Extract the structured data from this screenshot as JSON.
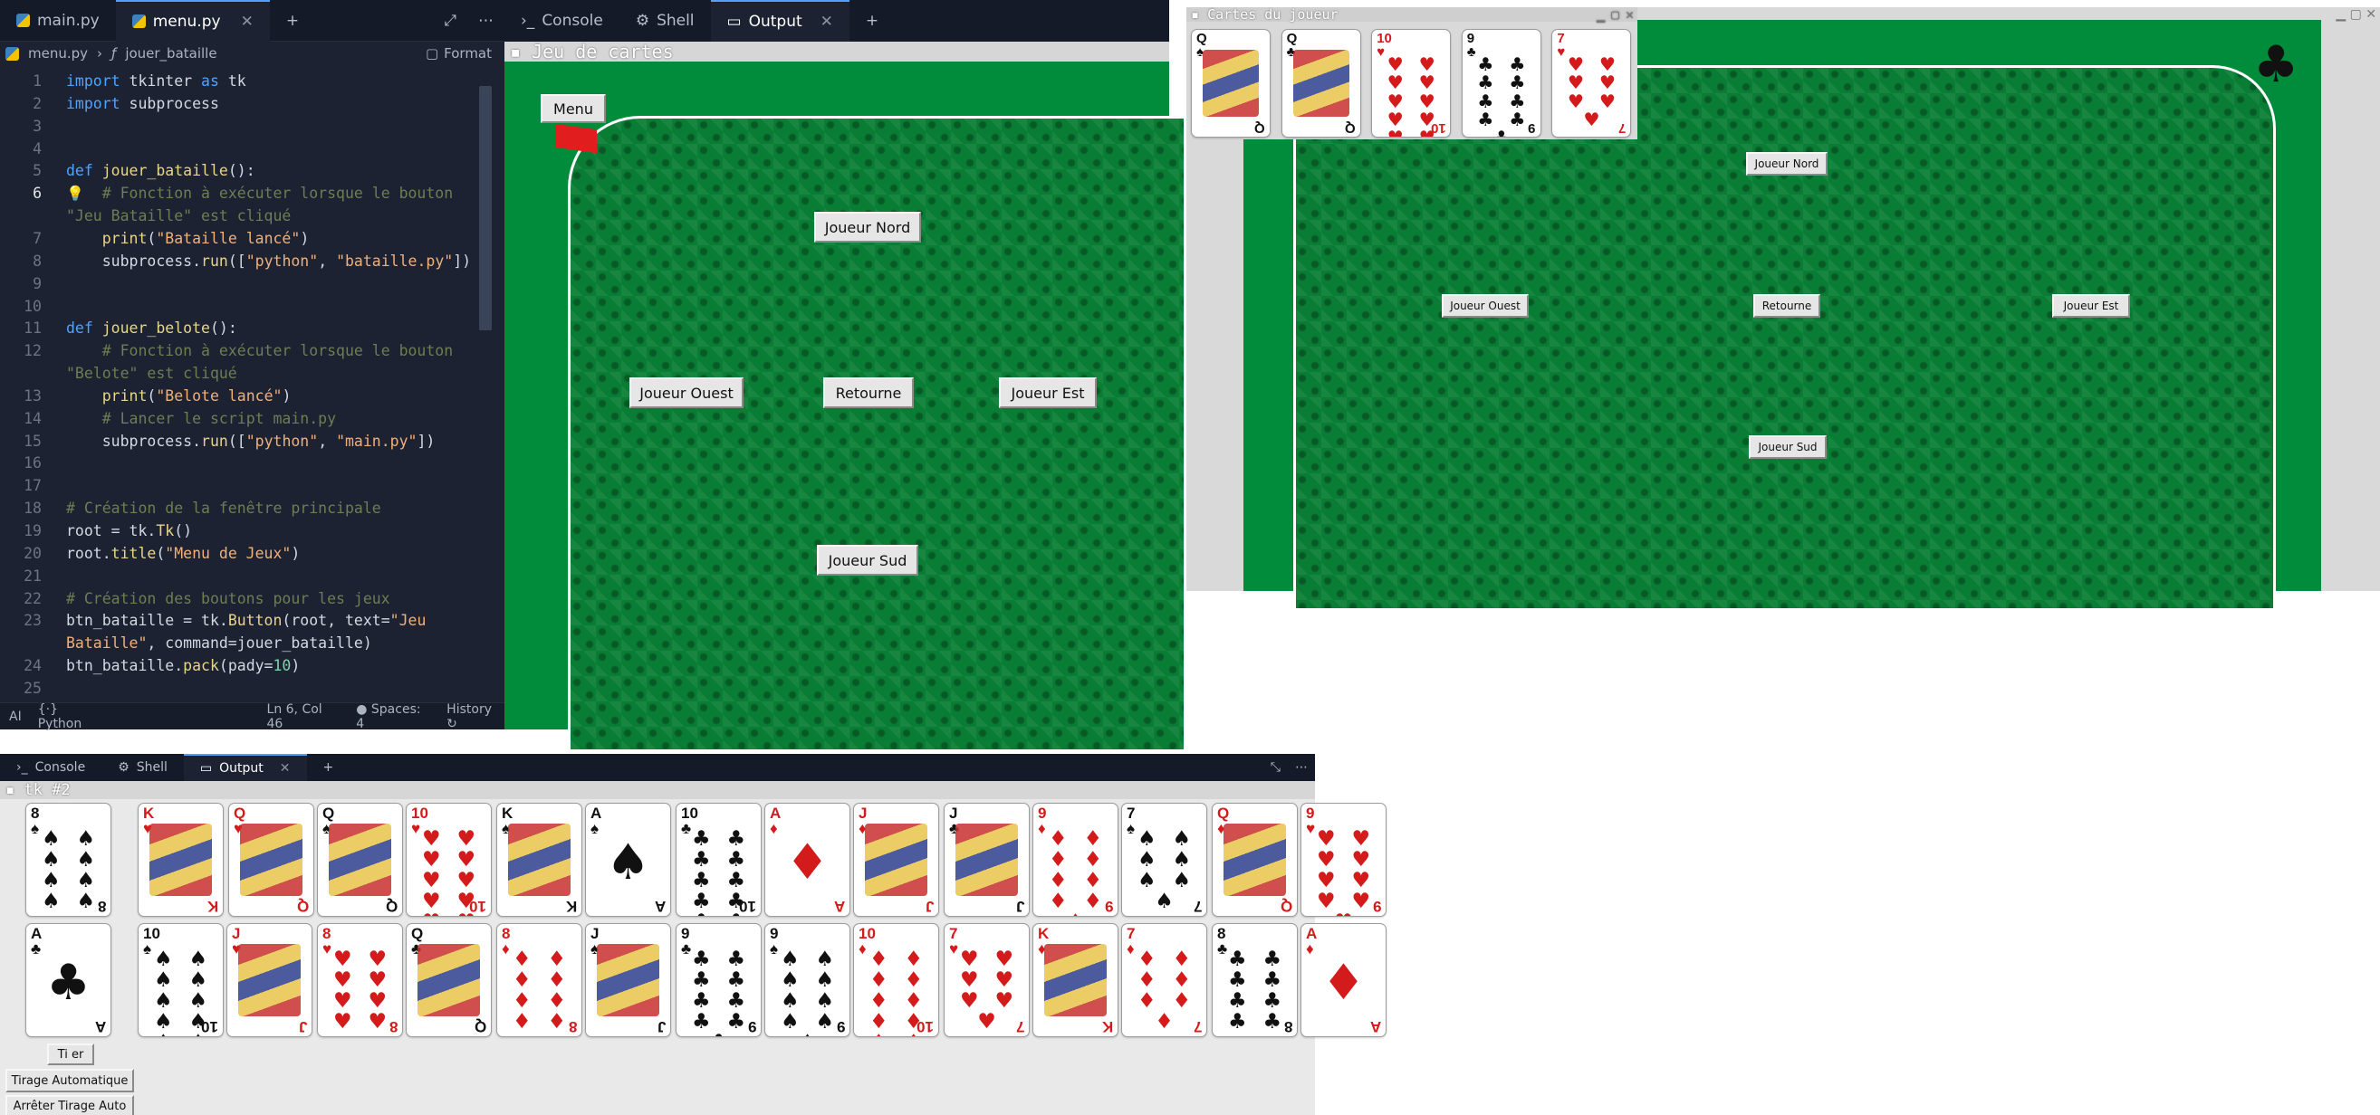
{
  "editor": {
    "tabs": [
      {
        "label": "main.py"
      },
      {
        "label": "menu.py"
      }
    ],
    "breadcrumb": {
      "file": "menu.py",
      "symbol": "jouer_bataille"
    },
    "format_label": "Format",
    "lines": [
      {
        "n": "1",
        "html": "<span class='kw'>import</span> tkinter <span class='kw'>as</span> tk"
      },
      {
        "n": "2",
        "html": "<span class='kw'>import</span> subprocess"
      },
      {
        "n": "3",
        "html": ""
      },
      {
        "n": "4",
        "html": ""
      },
      {
        "n": "5",
        "html": "<span class='kw'>def</span> <span class='fn'>jouer_bataille</span>():"
      },
      {
        "n": "6",
        "html": "    <span class='cm'># Fonction à exécuter lorsque le bouton</span>"
      },
      {
        "n": "",
        "html": "<span class='cm'>\"Jeu Bataille\" est cliqué</span>"
      },
      {
        "n": "7",
        "html": "    <span class='fn'>print</span>(<span class='st'>\"Bataille lancé\"</span>)"
      },
      {
        "n": "8",
        "html": "    subprocess.<span class='fn'>run</span>([<span class='st'>\"python\"</span>, <span class='st'>\"bataille.py\"</span>])"
      },
      {
        "n": "9",
        "html": ""
      },
      {
        "n": "10",
        "html": ""
      },
      {
        "n": "11",
        "html": "<span class='kw'>def</span> <span class='fn'>jouer_belote</span>():"
      },
      {
        "n": "12",
        "html": "    <span class='cm'># Fonction à exécuter lorsque le bouton</span>"
      },
      {
        "n": "",
        "html": "<span class='cm'>\"Belote\" est cliqué</span>"
      },
      {
        "n": "13",
        "html": "    <span class='fn'>print</span>(<span class='st'>\"Belote lancé\"</span>)"
      },
      {
        "n": "14",
        "html": "    <span class='cm'># Lancer le script main.py</span>"
      },
      {
        "n": "15",
        "html": "    subprocess.<span class='fn'>run</span>([<span class='st'>\"python\"</span>, <span class='st'>\"main.py\"</span>])"
      },
      {
        "n": "16",
        "html": ""
      },
      {
        "n": "17",
        "html": ""
      },
      {
        "n": "18",
        "html": "<span class='cm'># Création de la fenêtre principale</span>"
      },
      {
        "n": "19",
        "html": "root = tk.<span class='fn'>Tk</span>()"
      },
      {
        "n": "20",
        "html": "root.<span class='fn'>title</span>(<span class='st'>\"Menu de Jeux\"</span>)"
      },
      {
        "n": "21",
        "html": ""
      },
      {
        "n": "22",
        "html": "<span class='cm'># Création des boutons pour les jeux</span>"
      },
      {
        "n": "23",
        "html": "btn_bataille = tk.<span class='fn'>Button</span>(root, text=<span class='st'>\"Jeu</span>"
      },
      {
        "n": "",
        "html": "<span class='st'>Bataille\"</span>, command=jouer_bataille)"
      },
      {
        "n": "24",
        "html": "btn_bataille.<span class='fn'>pack</span>(pady=<span class='nm'>10</span>)"
      },
      {
        "n": "25",
        "html": ""
      }
    ],
    "status": {
      "ai": "AI",
      "lang": "Python",
      "pos": "Ln 6, Col 46",
      "spaces": "Spaces: 4",
      "history": "History"
    }
  },
  "panel_top": {
    "tabs": [
      "Console",
      "Shell",
      "Output"
    ],
    "window_title": "Jeu de cartes",
    "buttons": {
      "menu": "Menu",
      "nord": "Joueur Nord",
      "ouest": "Joueur Ouest",
      "retourne": "Retourne",
      "est": "Joueur Est",
      "sud": "Joueur Sud"
    }
  },
  "win_right": {
    "title": "Cartes du joueur",
    "hand": [
      {
        "r": "Q",
        "s": "♠",
        "c": "blk",
        "face": true
      },
      {
        "r": "Q",
        "s": "♣",
        "c": "blk",
        "face": true
      },
      {
        "r": "10",
        "s": "♥",
        "c": "red"
      },
      {
        "r": "9",
        "s": "♣",
        "c": "blk"
      },
      {
        "r": "7",
        "s": "♥",
        "c": "red"
      }
    ],
    "buttons": {
      "nord": "Joueur Nord",
      "ouest": "Joueur Ouest",
      "retourne": "Retourne",
      "est": "Joueur Est",
      "sud": "Joueur Sud"
    },
    "suit_icon": "♣"
  },
  "panel_bottom": {
    "tabs": [
      "Console",
      "Shell",
      "Output"
    ],
    "window_title": "tk #2",
    "row1": [
      {
        "r": "8",
        "s": "♠",
        "c": "blk"
      },
      {
        "r": "K",
        "s": "♥",
        "c": "red",
        "face": true
      },
      {
        "r": "Q",
        "s": "♥",
        "c": "red",
        "face": true
      },
      {
        "r": "Q",
        "s": "♠",
        "c": "blk",
        "face": true
      },
      {
        "r": "10",
        "s": "♥",
        "c": "red"
      },
      {
        "r": "K",
        "s": "♠",
        "c": "blk",
        "face": true
      },
      {
        "r": "A",
        "s": "♠",
        "c": "blk"
      },
      {
        "r": "10",
        "s": "♣",
        "c": "blk"
      },
      {
        "r": "A",
        "s": "♦",
        "c": "red"
      },
      {
        "r": "J",
        "s": "♦",
        "c": "red",
        "face": true
      },
      {
        "r": "J",
        "s": "♣",
        "c": "blk",
        "face": true
      },
      {
        "r": "9",
        "s": "♦",
        "c": "red"
      },
      {
        "r": "7",
        "s": "♠",
        "c": "blk"
      },
      {
        "r": "Q",
        "s": "♦",
        "c": "red",
        "face": true
      },
      {
        "r": "9",
        "s": "♥",
        "c": "red"
      }
    ],
    "row2": [
      {
        "r": "A",
        "s": "♣",
        "c": "blk"
      },
      {
        "r": "10",
        "s": "♠",
        "c": "blk"
      },
      {
        "r": "J",
        "s": "♥",
        "c": "red",
        "face": true
      },
      {
        "r": "8",
        "s": "♥",
        "c": "red"
      },
      {
        "r": "Q",
        "s": "♣",
        "c": "blk",
        "face": true
      },
      {
        "r": "8",
        "s": "♦",
        "c": "red"
      },
      {
        "r": "J",
        "s": "♠",
        "c": "blk",
        "face": true
      },
      {
        "r": "9",
        "s": "♣",
        "c": "blk"
      },
      {
        "r": "9",
        "s": "♠",
        "c": "blk"
      },
      {
        "r": "10",
        "s": "♦",
        "c": "red"
      },
      {
        "r": "7",
        "s": "♥",
        "c": "red"
      },
      {
        "r": "K",
        "s": "♦",
        "c": "red",
        "face": true
      },
      {
        "r": "7",
        "s": "♦",
        "c": "red"
      },
      {
        "r": "8",
        "s": "♣",
        "c": "blk"
      },
      {
        "r": "A",
        "s": "♦",
        "c": "red"
      }
    ],
    "buttons": {
      "tirer": "Ti er",
      "auto": "Tirage Automatique",
      "stop": "Arrêter Tirage Auto"
    }
  },
  "colors": {
    "felt": "#008c3a",
    "editor_bg": "#1c2231",
    "accent": "#4fa3ff"
  }
}
